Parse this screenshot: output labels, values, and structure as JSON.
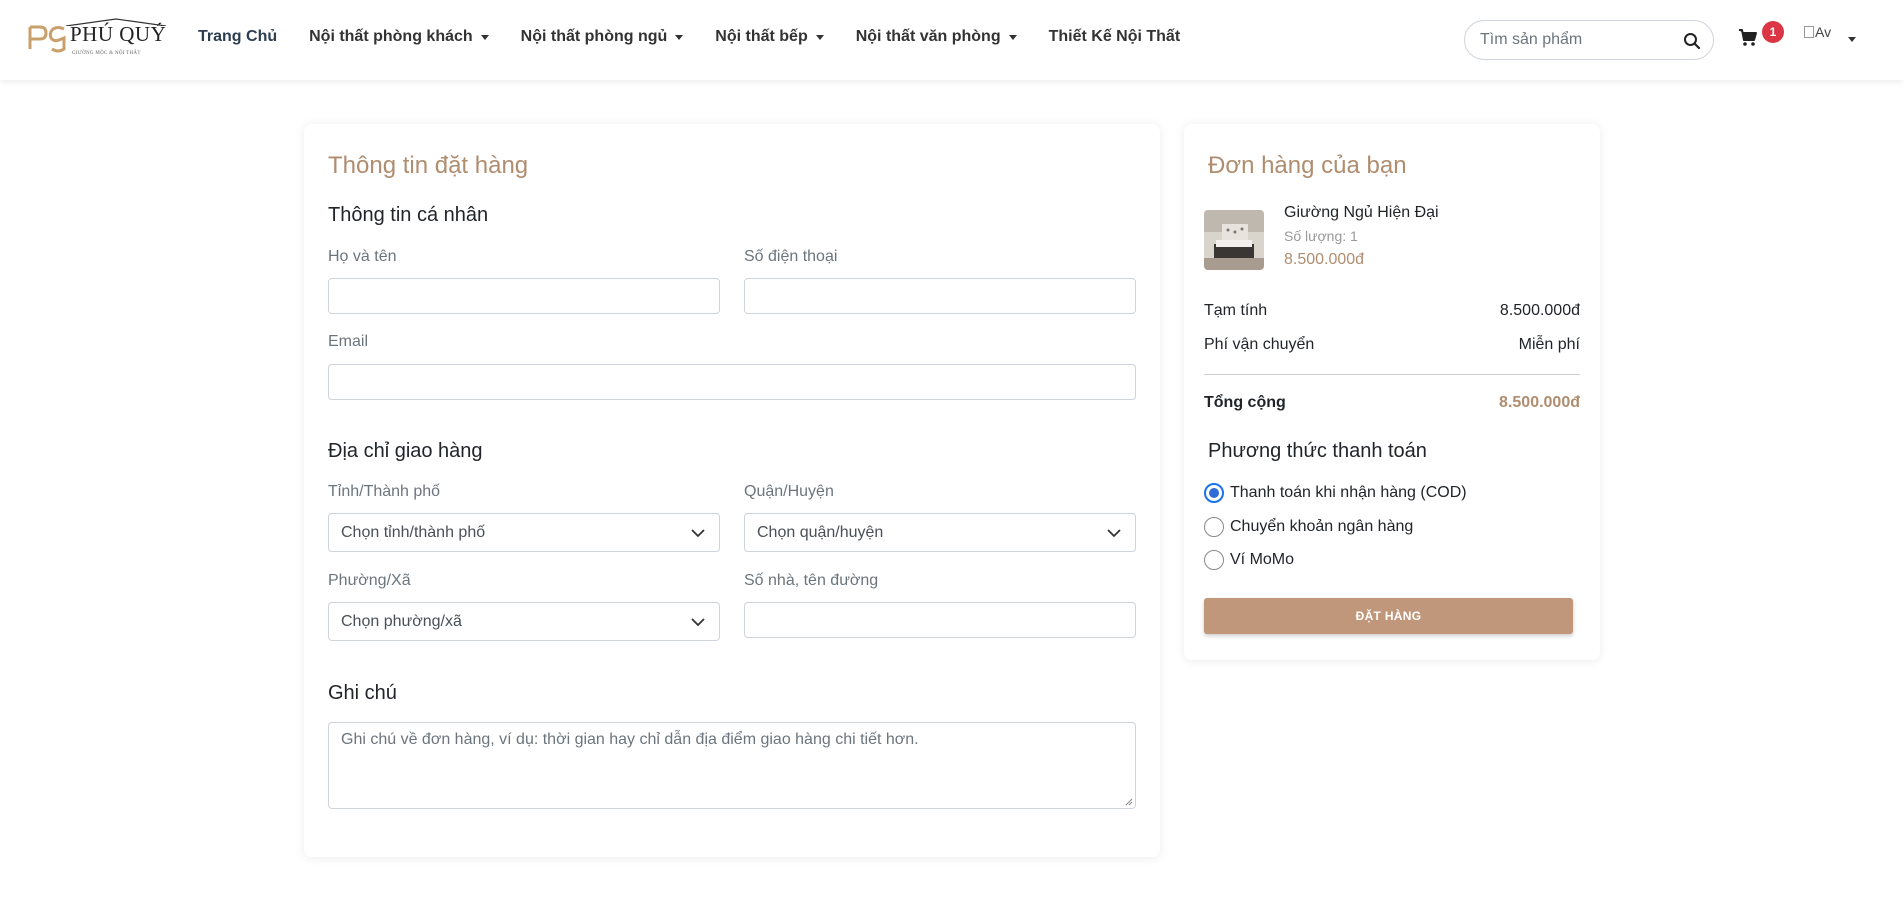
{
  "brand": {
    "name": "PHÚ QUÝ",
    "tagline": "GIƯỜNG MỘC & NỘI THẤT",
    "accent_color": "#b08d6f",
    "button_color": "#c0977a"
  },
  "nav": {
    "items": [
      {
        "label": "Trang Chủ",
        "dropdown": false
      },
      {
        "label": "Nội thất phòng khách",
        "dropdown": true
      },
      {
        "label": "Nội thất phòng ngủ",
        "dropdown": true
      },
      {
        "label": "Nội thất bếp",
        "dropdown": true
      },
      {
        "label": "Nội thất văn phòng",
        "dropdown": true
      },
      {
        "label": "Thiết Kế Nội Thất",
        "dropdown": false
      }
    ],
    "search_placeholder": "Tìm sản phẩm",
    "cart_count": "1",
    "avatar_alt": "Av"
  },
  "checkout": {
    "title": "Thông tin đặt hàng",
    "personal": {
      "heading": "Thông tin cá nhân",
      "name_label": "Họ và tên",
      "phone_label": "Số điện thoại",
      "email_label": "Email",
      "name_value": "",
      "phone_value": "",
      "email_value": ""
    },
    "address": {
      "heading": "Địa chỉ giao hàng",
      "province_label": "Tỉnh/Thành phố",
      "province_value": "Chọn tỉnh/thành phố",
      "district_label": "Quận/Huyện",
      "district_value": "Chọn quận/huyện",
      "ward_label": "Phường/Xã",
      "ward_value": "Chọn phường/xã",
      "street_label": "Số nhà, tên đường",
      "street_value": ""
    },
    "note": {
      "heading": "Ghi chú",
      "placeholder": "Ghi chú về đơn hàng, ví dụ: thời gian hay chỉ dẫn địa điểm giao hàng chi tiết hơn."
    }
  },
  "order": {
    "title": "Đơn hàng của bạn",
    "item": {
      "name": "Giường Ngủ Hiện Đại",
      "quantity": "Số lượng: 1",
      "price": "8.500.000đ"
    },
    "subtotal_label": "Tạm tính",
    "subtotal_value": "8.500.000đ",
    "shipping_label": "Phí vận chuyển",
    "shipping_value": "Miễn phí",
    "total_label": "Tổng cộng",
    "total_value": "8.500.000đ",
    "payment_heading": "Phương thức thanh toán",
    "payment_methods": [
      {
        "label": "Thanh toán khi nhận hàng (COD)",
        "selected": true
      },
      {
        "label": "Chuyển khoản ngân hàng",
        "selected": false
      },
      {
        "label": "Ví MoMo",
        "selected": false
      }
    ],
    "submit_label": "ĐẶT HÀNG"
  }
}
